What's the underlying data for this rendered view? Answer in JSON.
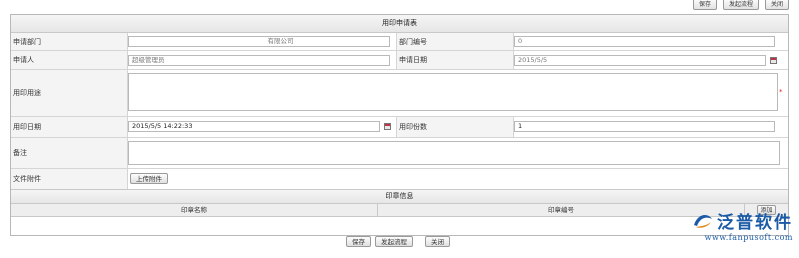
{
  "top_actions": [
    "保存",
    "发起流程",
    "关闭"
  ],
  "form": {
    "title": "用印申请表",
    "fields": {
      "dept_label": "申请部门",
      "dept_value": "有限公司",
      "dept_no_label": "部门编号",
      "dept_no_value": "0",
      "applicant_label": "申请人",
      "applicant_value": "超级管理员",
      "apply_date_label": "申请日期",
      "apply_date_value": "2015/5/5",
      "purpose_label": "用印用途",
      "purpose_required": "*",
      "use_date_label": "用印日期",
      "use_date_value": "2015/5/5 14:22:33",
      "copies_label": "用印份数",
      "copies_value": "1",
      "remark_label": "备注",
      "attachment_label": "文件附件",
      "upload_button": "上传附件"
    },
    "seal_section": {
      "title": "印章信息",
      "col_name": "印章名称",
      "col_no": "印章编号",
      "add_button": "添加"
    }
  },
  "bottom_actions": {
    "save": "保存",
    "start_flow": "发起流程",
    "close": "关闭"
  },
  "logo": {
    "brand": "泛普软件",
    "url": "www.fanpusoft.com",
    "primary_color": "#1b5aa6",
    "accent_color": "#e38a1e"
  }
}
